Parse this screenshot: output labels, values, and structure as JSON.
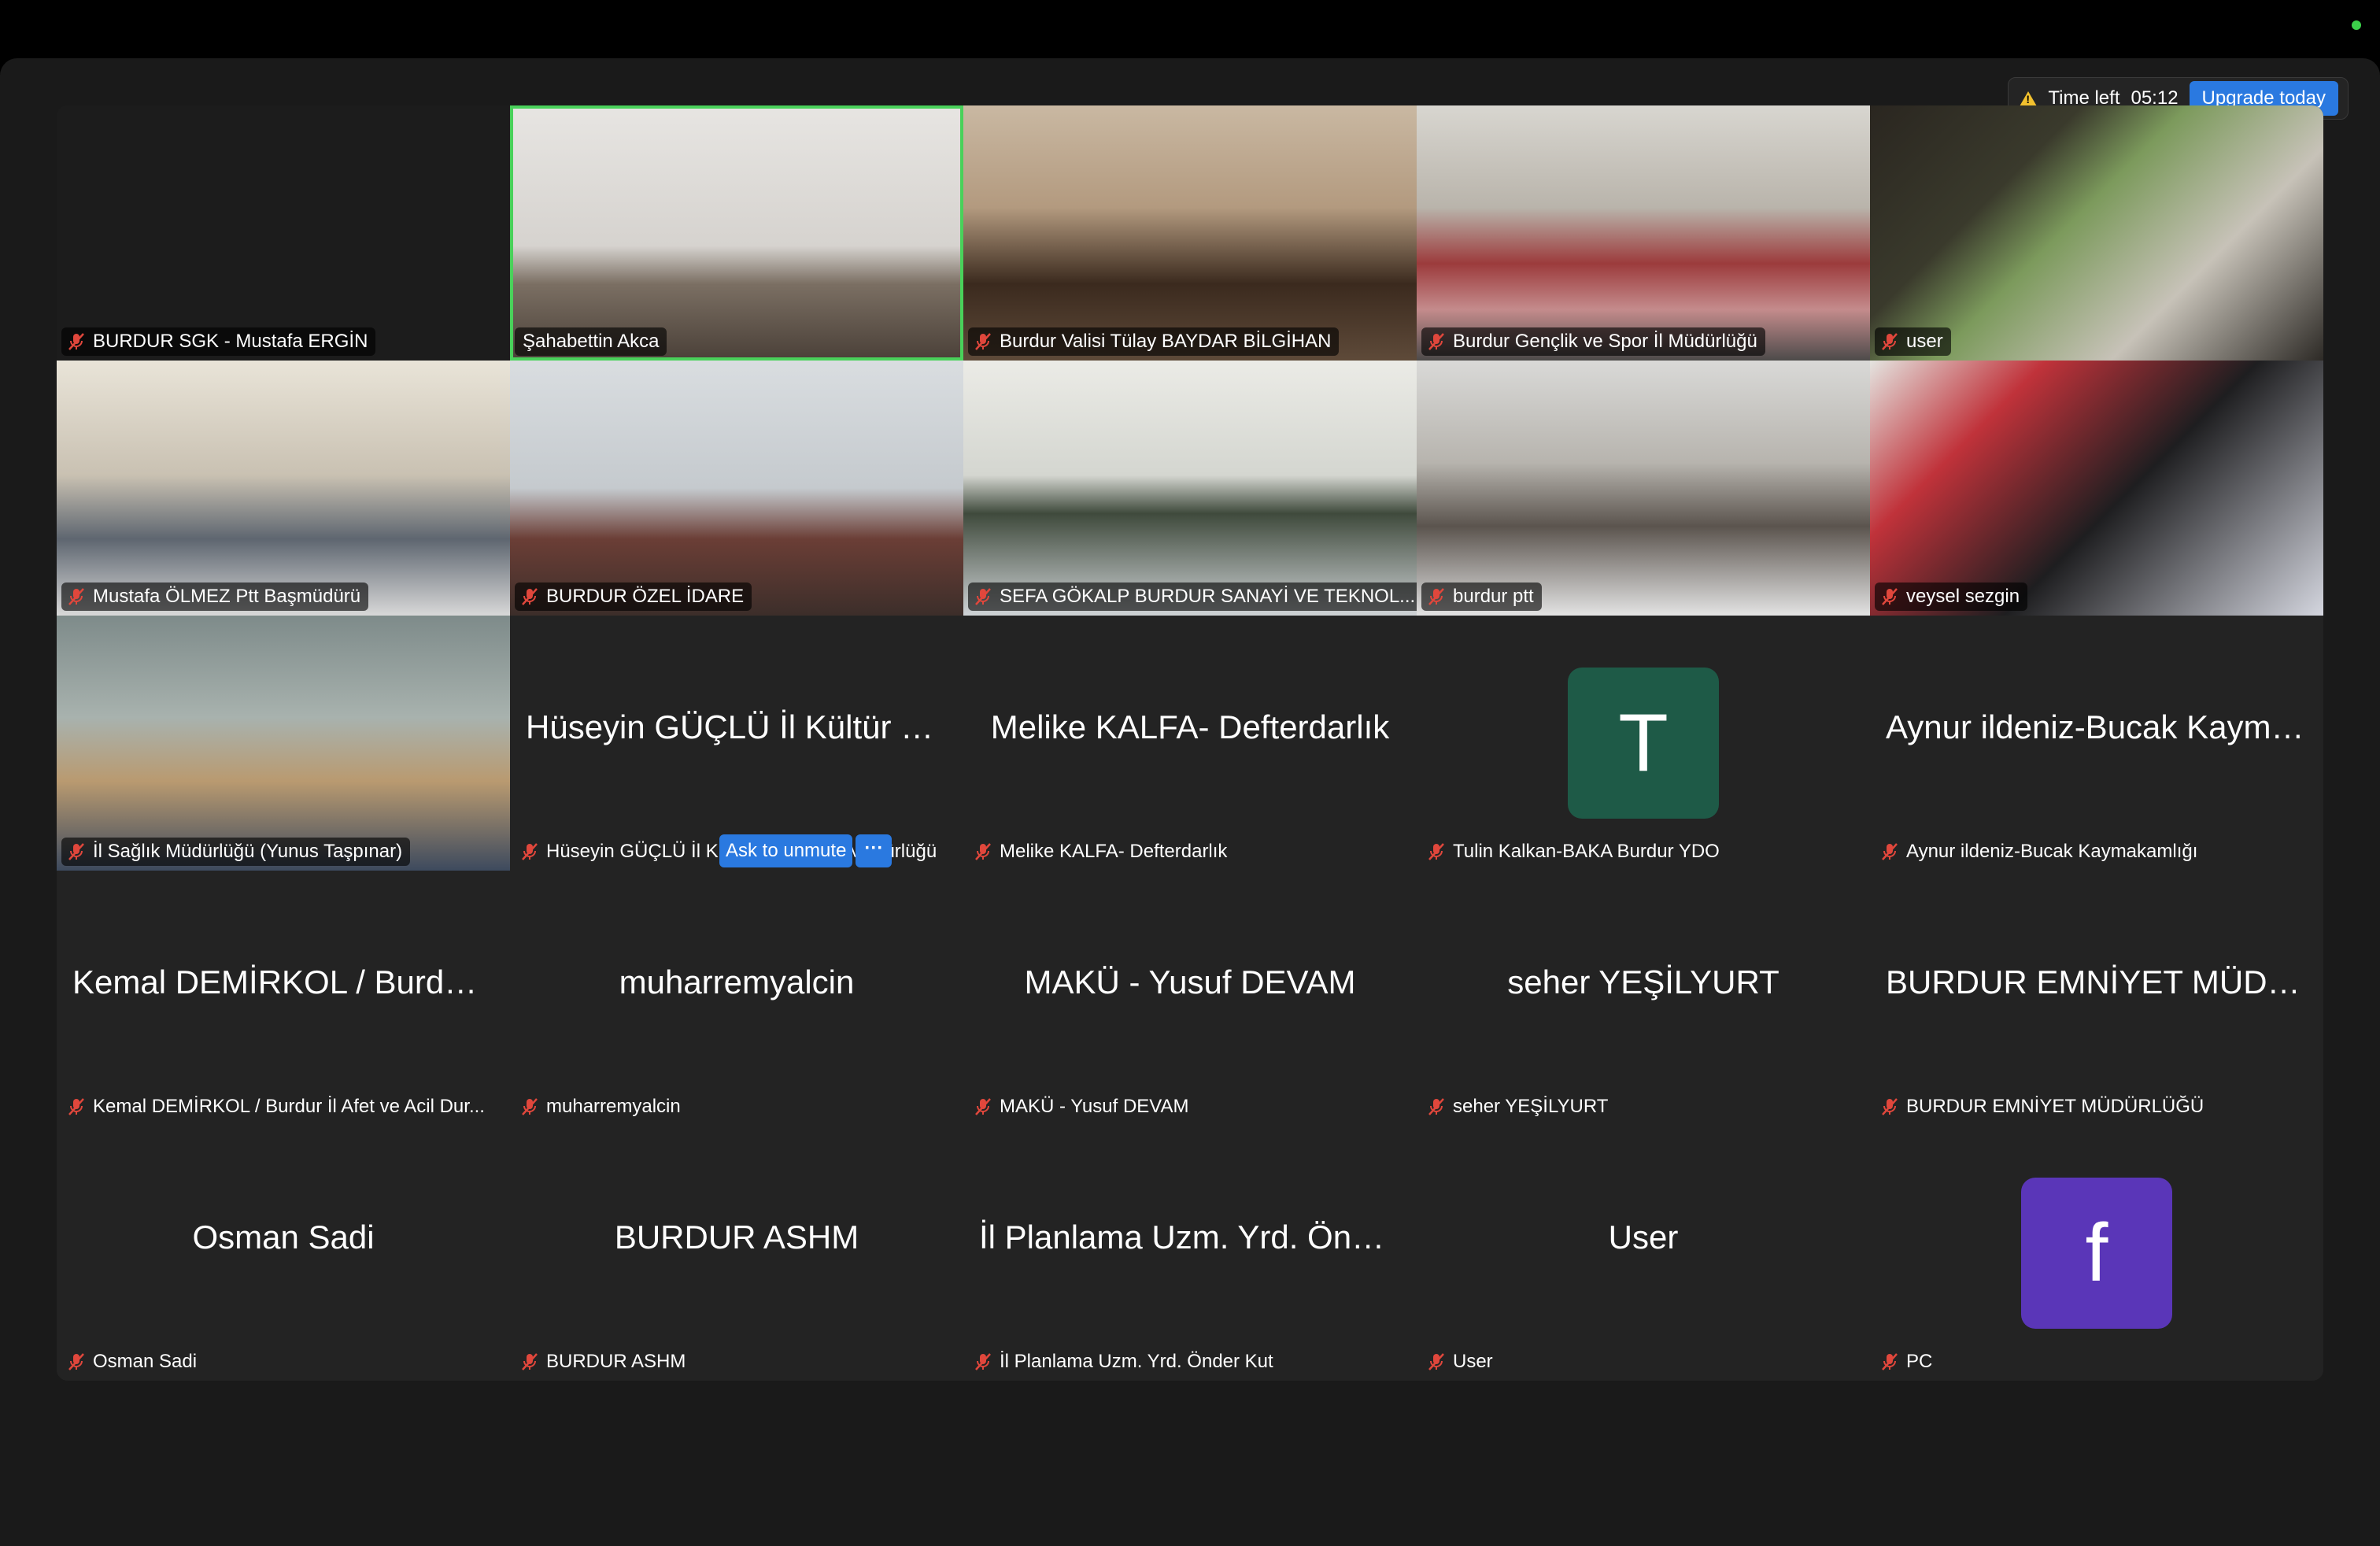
{
  "timer": {
    "label": "Time left",
    "value": "05:12",
    "upgrade_label": "Upgrade today"
  },
  "colors": {
    "accent": "#2a79e0",
    "active_speaker": "#49d15a",
    "mute": "#e0473c",
    "warning": "#f2c12e"
  },
  "participants": [
    {
      "name": "BURDUR SGK - Mustafa ERGİN",
      "video": "off"
    },
    {
      "name": "Şahabettin Akca",
      "video": "on",
      "active_speaker": true
    },
    {
      "name": "Burdur Valisi Tülay BAYDAR BİLGİHAN",
      "video": "on"
    },
    {
      "name": "Burdur Gençlik ve Spor İl Müdürlüğü",
      "video": "on"
    },
    {
      "name": "user",
      "video": "on"
    },
    {
      "name": "Mustafa ÖLMEZ  Ptt Başmüdürü",
      "video": "on"
    },
    {
      "name": "BURDUR ÖZEL İDARE",
      "video": "on"
    },
    {
      "name": "SEFA GÖKALP BURDUR SANAYİ VE TEKNOL...",
      "video": "on"
    },
    {
      "name": "burdur ptt",
      "video": "on"
    },
    {
      "name": "veysel sezgin",
      "video": "on"
    },
    {
      "name": "İl Sağlık Müdürlüğü (Yunus Taşpınar)",
      "video": "on"
    },
    {
      "name": "Hüseyin GÜÇLÜ İl Kültür ve Turizm Müdürlüğü",
      "display": "Hüseyin GÜÇLÜ İl Kültür ve...",
      "video": "off"
    },
    {
      "name": "Melike KALFA- Defterdarlık",
      "display": "Melike KALFA- Defterdarlık",
      "video": "off"
    },
    {
      "name": "Tulin Kalkan-BAKA Burdur YDO",
      "avatar": "T",
      "avatar_color": "#1e5a47",
      "video": "off"
    },
    {
      "name": "Aynur ildeniz-Bucak Kaymakamlığı",
      "display": "Aynur ildeniz-Bucak Kayma...",
      "video": "off"
    },
    {
      "name": "Kemal DEMİRKOL / Burdur İl Afet ve Acil Dur...",
      "display": "Kemal DEMİRKOL / Burdur İl...",
      "video": "off"
    },
    {
      "name": "muharremyalcin",
      "display": "muharremyalcin",
      "video": "off"
    },
    {
      "name": "MAKÜ - Yusuf DEVAM",
      "display": "MAKÜ - Yusuf DEVAM",
      "video": "off"
    },
    {
      "name": "seher YEŞİLYURT",
      "display": "seher YEŞİLYURT",
      "video": "off"
    },
    {
      "name": "BURDUR EMNİYET MÜDÜRLÜĞÜ",
      "display": "BURDUR EMNİYET MÜDÜR...",
      "video": "off"
    },
    {
      "name": "Osman Sadi",
      "display": "Osman Sadi",
      "video": "off"
    },
    {
      "name": "BURDUR ASHM",
      "display": "BURDUR ASHM",
      "video": "off"
    },
    {
      "name": "İl Planlama Uzm. Yrd. Önder Kut",
      "display": "İl Planlama Uzm. Yrd. Önder...",
      "video": "off"
    },
    {
      "name": "User",
      "display": "User",
      "video": "off"
    },
    {
      "name": "PC",
      "avatar": "f",
      "avatar_color": "#5a36b8",
      "video": "off"
    }
  ],
  "hover_actions": {
    "ask_to_unmute": "Ask to unmute",
    "more": "···"
  }
}
